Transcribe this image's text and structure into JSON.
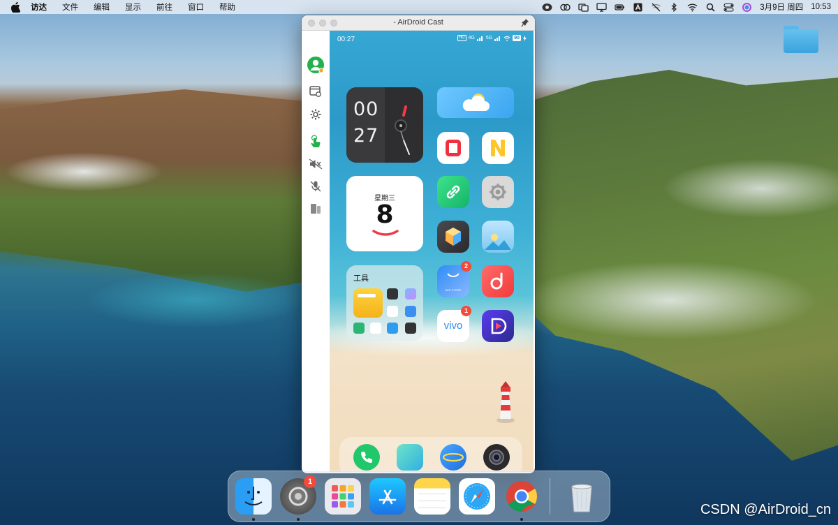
{
  "menubar": {
    "items": [
      "访达",
      "文件",
      "编辑",
      "显示",
      "前往",
      "窗口",
      "帮助"
    ],
    "date": "3月9日 周四",
    "time": "10:53",
    "status_icons": [
      "airdroid-icon",
      "mission-icon",
      "screen-icon",
      "display-icon",
      "battery-icon",
      "text-input-icon",
      "wifi-off-icon",
      "bluetooth-icon",
      "wifi-icon",
      "search-icon",
      "control-center-icon",
      "siri-icon"
    ]
  },
  "window": {
    "title": "- AirDroid Cast",
    "toolbar": [
      "account-icon",
      "window-icon",
      "settings-icon",
      "touch-control-icon",
      "speaker-mute-icon",
      "mic-mute-icon",
      "fullscreen-icon"
    ]
  },
  "phone": {
    "status": {
      "time": "00:27",
      "signal_label": "4G",
      "signal2_label": "5G",
      "battery": "90"
    },
    "clock_widget": {
      "hour": "00",
      "minute": "27"
    },
    "date_widget": {
      "weekday": "星期三",
      "day": "8"
    },
    "folder_widget": {
      "title": "工具"
    },
    "apps": {
      "vivo_label": "vivo",
      "store_label": "APP STORE",
      "store_badge": "2",
      "vivo_badge": "1"
    }
  },
  "dock": {
    "apps": [
      "Finder",
      "System Preferences",
      "Launchpad",
      "App Store",
      "Notes",
      "Safari",
      "Chrome",
      "Trash"
    ],
    "settings_badge": "1"
  },
  "watermark": "CSDN @AirDroid_cn",
  "colors": {
    "menubar_bg": "#e4ecf4",
    "badge_red": "#f24a3b",
    "dock_bg": "#d2e1ec"
  }
}
